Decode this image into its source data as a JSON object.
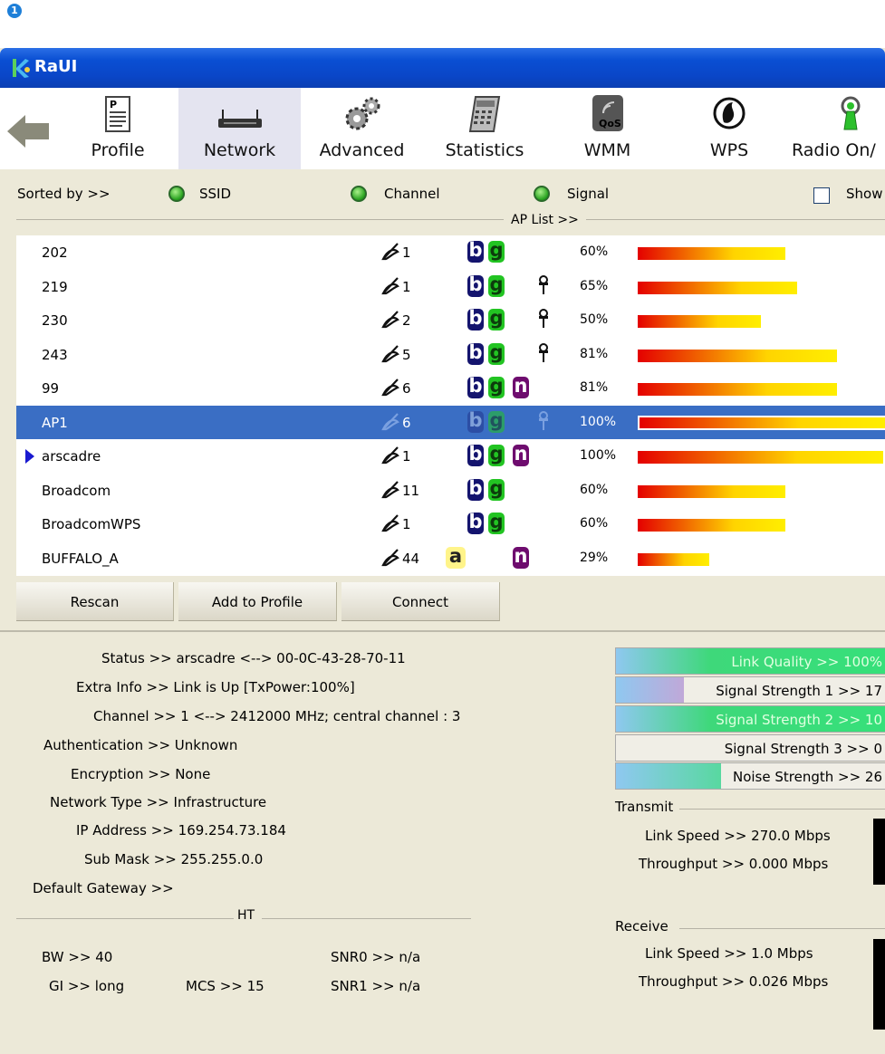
{
  "step_badge": "1",
  "window": {
    "title": "RaUI"
  },
  "toolbar": {
    "items": [
      {
        "label": "Profile",
        "icon": "profile-icon"
      },
      {
        "label": "Network",
        "icon": "network-icon"
      },
      {
        "label": "Advanced",
        "icon": "advanced-icon"
      },
      {
        "label": "Statistics",
        "icon": "statistics-icon"
      },
      {
        "label": "WMM",
        "icon": "wmm-icon",
        "icon_text": "QoS"
      },
      {
        "label": "WPS",
        "icon": "wps-icon"
      },
      {
        "label": "Radio On/",
        "icon": "radio-icon"
      }
    ],
    "active": "Network"
  },
  "sort": {
    "label": "Sorted by >>",
    "options": [
      "SSID",
      "Channel",
      "Signal"
    ],
    "show_label": "Show"
  },
  "aplist": {
    "title": "AP List >>",
    "rows": [
      {
        "ssid": "202",
        "channel": "1",
        "modes": [
          "b",
          "g"
        ],
        "secured": false,
        "signal": "60%",
        "signal_value": 60
      },
      {
        "ssid": "219",
        "channel": "1",
        "modes": [
          "b",
          "g"
        ],
        "secured": true,
        "signal": "65%",
        "signal_value": 65
      },
      {
        "ssid": "230",
        "channel": "2",
        "modes": [
          "b",
          "g"
        ],
        "secured": true,
        "signal": "50%",
        "signal_value": 50
      },
      {
        "ssid": "243",
        "channel": "5",
        "modes": [
          "b",
          "g"
        ],
        "secured": true,
        "signal": "81%",
        "signal_value": 81
      },
      {
        "ssid": "99",
        "channel": "6",
        "modes": [
          "b",
          "g",
          "n"
        ],
        "secured": false,
        "signal": "81%",
        "signal_value": 81
      },
      {
        "ssid": "AP1",
        "channel": "6",
        "modes": [
          "b",
          "g"
        ],
        "secured": true,
        "signal": "100%",
        "signal_value": 100,
        "selected": true
      },
      {
        "ssid": "arscadre",
        "channel": "1",
        "modes": [
          "b",
          "g",
          "n"
        ],
        "secured": false,
        "signal": "100%",
        "signal_value": 100,
        "connected": true
      },
      {
        "ssid": "Broadcom",
        "channel": "11",
        "modes": [
          "b",
          "g"
        ],
        "secured": false,
        "signal": "60%",
        "signal_value": 60
      },
      {
        "ssid": "BroadcomWPS",
        "channel": "1",
        "modes": [
          "b",
          "g"
        ],
        "secured": false,
        "signal": "60%",
        "signal_value": 60
      },
      {
        "ssid": "BUFFALO_A",
        "channel": "44",
        "modes": [
          "a",
          "n"
        ],
        "secured": false,
        "signal": "29%",
        "signal_value": 29
      }
    ]
  },
  "buttons": {
    "rescan": "Rescan",
    "add_to_profile": "Add to Profile",
    "connect": "Connect"
  },
  "status": {
    "status": "Status >> arscadre <--> 00-0C-43-28-70-11",
    "extra_info": "Extra Info >> Link is Up [TxPower:100%]",
    "channel": "Channel >> 1 <--> 2412000 MHz; central channel : 3",
    "authentication": "Authentication >> Unknown",
    "encryption": "Encryption >> None",
    "network_type": "Network Type >> Infrastructure",
    "ip_address": "IP Address >> 169.254.73.184",
    "sub_mask": "Sub Mask >> 255.255.0.0",
    "default_gateway": "Default Gateway >>"
  },
  "ht": {
    "title": "HT",
    "bw": "BW >> 40",
    "gi": "GI >> long",
    "mcs": "MCS >> 15",
    "snr0": "SNR0 >> n/a",
    "snr1": "SNR1 >> n/a"
  },
  "meters": {
    "link_quality": {
      "label": "Link Quality >> 100%",
      "value": 100
    },
    "signal_1": {
      "label": "Signal Strength 1 >> 17",
      "value": 25
    },
    "signal_2": {
      "label": "Signal Strength 2 >> 10",
      "value": 100
    },
    "signal_3": {
      "label": "Signal Strength 3 >> 0",
      "value": 0
    },
    "noise": {
      "label": "Noise Strength >> 26",
      "value": 39
    }
  },
  "transmit": {
    "title": "Transmit",
    "link_speed": "Link Speed >> 270.0 Mbps",
    "throughput": "Throughput >> 0.000 Mbps"
  },
  "receive": {
    "title": "Receive",
    "link_speed": "Link Speed >> 1.0 Mbps",
    "throughput": "Throughput >> 0.026 Mbps"
  },
  "colors": {
    "selection": "#3a6ec4",
    "window_bg": "#ece9d8",
    "title_bar": "#0a4fd3",
    "meter_green": "#3ed87a",
    "meter_purple": "#c0a8d8",
    "meter_blue": "#8fc8f0"
  }
}
